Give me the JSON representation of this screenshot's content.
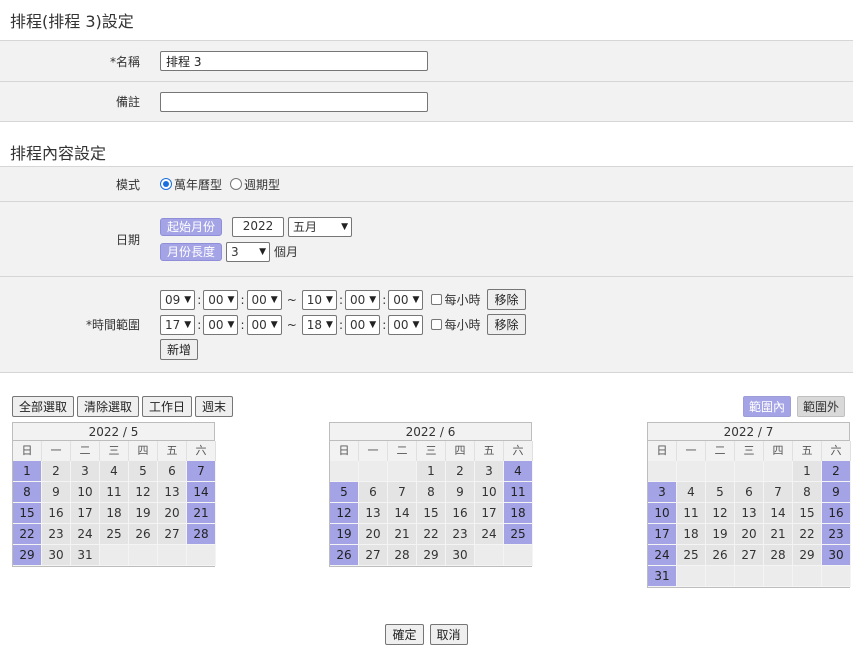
{
  "schedule": {
    "title": "排程(排程 3)設定",
    "name_label": "*名稱",
    "name_value": "排程 3",
    "note_label": "備註",
    "note_value": ""
  },
  "content": {
    "title": "排程內容設定",
    "mode_label": "模式",
    "mode_options": [
      "萬年曆型",
      "週期型"
    ],
    "mode_selected": "萬年曆型",
    "date_label": "日期",
    "start_month_tag": "起始月份",
    "start_year": "2022",
    "start_month": "五月",
    "length_tag": "月份長度",
    "length_value": "3",
    "length_unit": "個月",
    "time_label": "*時間範圍",
    "time_ranges": [
      {
        "start_h": "09",
        "start_m": "00",
        "start_s": "00",
        "end_h": "10",
        "end_m": "00",
        "end_s": "00"
      },
      {
        "start_h": "17",
        "start_m": "00",
        "start_s": "00",
        "end_h": "18",
        "end_m": "00",
        "end_s": "00"
      }
    ],
    "hourly_label": "每小時",
    "remove_label": "移除",
    "add_label": "新增",
    "tilde": "~",
    "colon": ":"
  },
  "toolbar": {
    "select_all": "全部選取",
    "clear_selection": "清除選取",
    "workdays": "工作日",
    "weekend": "週末",
    "in_range": "範圍內",
    "out_range": "範圍外"
  },
  "weekdays": [
    "日",
    "一",
    "二",
    "三",
    "四",
    "五",
    "六"
  ],
  "calendars": [
    {
      "title": "2022 / 5",
      "offset": 0,
      "days": 31
    },
    {
      "title": "2022 / 6",
      "offset": 3,
      "days": 30
    },
    {
      "title": "2022 / 7",
      "offset": 5,
      "days": 31
    }
  ],
  "footer": {
    "confirm": "確定",
    "cancel": "取消"
  },
  "colors": {
    "accent": "#a4a3e6",
    "row_bg": "#f2f2f2"
  }
}
